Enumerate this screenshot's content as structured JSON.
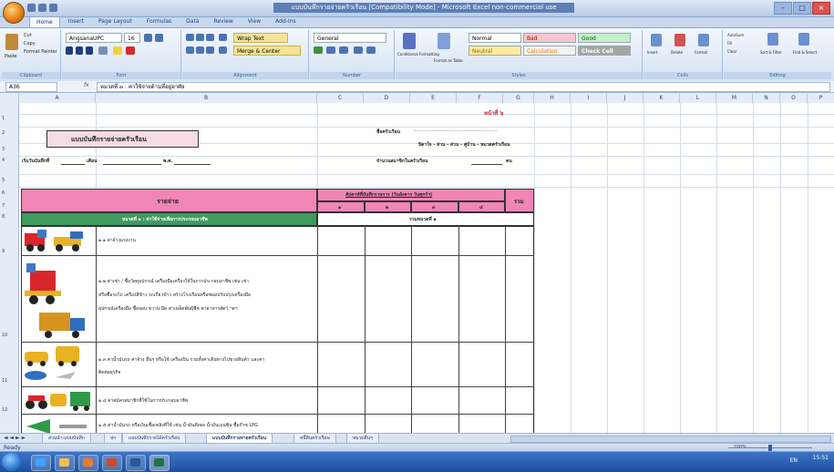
{
  "window": {
    "title": "แบบบันทึกรายจ่ายครัวเรือน [Compatibility Mode] - Microsoft Excel non-commercial use"
  },
  "ribbon": {
    "tabs": [
      "Home",
      "Insert",
      "Page Layout",
      "Formulas",
      "Data",
      "Review",
      "View",
      "Add-Ins"
    ],
    "groups": {
      "clipboard": "Clipboard",
      "font": "Font",
      "alignment": "Alignment",
      "number": "Number",
      "styles": "Styles",
      "cells": "Cells",
      "editing": "Editing"
    },
    "clipboard_items": [
      "Cut",
      "Copy",
      "Format Painter"
    ],
    "paste_label": "Paste",
    "font_name": "AngsanaUPC",
    "font_size": "16",
    "wrap_text": "Wrap Text",
    "merge_center": "Merge & Center",
    "number_format": "General",
    "conditional_formatting": "Conditional Formatting",
    "format_as_table": "Format as Table",
    "styles": {
      "normal": "Normal",
      "bad": "Bad",
      "good": "Good",
      "neutral": "Neutral",
      "calculation": "Calculation",
      "check_cell": "Check Cell"
    },
    "cells_items": [
      "Insert",
      "Delete",
      "Format"
    ],
    "editing_items": [
      "AutoSum",
      "Fill",
      "Clear",
      "Sort & Filter",
      "Find & Select"
    ]
  },
  "formula_bar": {
    "name_box": "A36",
    "fx": "fx",
    "value": "หมวดที่ ๓ : ค่าใช้จ่ายด้านที่อยู่อาศัย"
  },
  "columns": [
    "A",
    "B",
    "C",
    "D",
    "E",
    "F",
    "G",
    "H",
    "I",
    "J",
    "K",
    "L",
    "M",
    "N",
    "O",
    "P"
  ],
  "rows": [
    "1",
    "2",
    "3",
    "4",
    "5",
    "6",
    "7",
    "8",
    "9",
    "10",
    "11",
    "12"
  ],
  "sheet": {
    "page_no": "หน้าที่ ๖",
    "form_title": "แบบบันทึกรายจ่ายครัวเรือน",
    "recorder_label": "ชื่อครัวเรือน",
    "recorder_fill": "..........................................................",
    "relation_label": "บิดาใจ - ส่วน - ส่วน - คู่บ้าน - หมวดครัวเรือน",
    "start_date_label": "เริ่มวันบันทึกที่",
    "month_label": "เดือน",
    "year_label": "พ.ศ.",
    "members_label": "จำนวนสมาชิกในครัวเรือน",
    "members_unit": "คน",
    "header_item": "รายจ่าย",
    "header_weeks": "สัปดาห์ที่บันทึกรายการ (วันอังคาร วันศุกร์ฯ)",
    "week_numbers": [
      "๑",
      "๒",
      "๓",
      "๔"
    ],
    "header_total": "รวม",
    "category_row": "หมวดที่ ๑ : ค่าใช้จ่ายเพื่อการประกอบอาชีพ",
    "category_total": "รวมหมวดที่ ๑",
    "items": [
      {
        "text": "๑.๑ ค่าจ้างแรงงาน"
      },
      {
        "text_lines": [
          "๑.๒ ค่าเช่า / ซื้อวัสดุอุปกรณ์ เครื่องมือเครื่องใช้ในการประกอบอาชีพ เช่น เช่า",
          "หรือซื้อรถไถ เครื่องสีข้าว รถเกี่ยวข้าว สร้างโรงเรือนหรือซ่อมปรับปรุงเครื่องมือ",
          "อุปกรณ์เครื่องมือ ซื้อจอบ ขวาน มีด ค่าเมล็ดพันธุ์พืช ค่าอาหารสัตว์ ฯลฯ"
        ]
      },
      {
        "text_lines": [
          "๑.๓ ค่าน้ำมันรถ ค่าจ้าง อื่นๆ หรือใช้ เครื่องบิน รวมทั้งค่าเดินทางไปขายสินค้า และค่า",
          "ติดต่อธุรกิจ"
        ]
      },
      {
        "text": "๑.๔ ค่าสมัครสมาชิกที่ใช้ในการประกอบอาชีพ"
      },
      {
        "text": "๑.๕ ค่าน้ำมันรถ หรือเงินเชื้อเพลิงที่ใช้ เช่น น้ำมันดีเซล น้ำมันเบนซิน ซื้อก๊าซ LPG"
      }
    ]
  },
  "sheet_tabs": [
    "ส่วนนำ-แบบบันทึก",
    "ปก",
    "แบบบันทึกรายได้ครัวเรือน",
    "แบบบันทึกรายจ่ายครัวเรือน",
    "หนี้สินครัวเรือน",
    "หมวดอื่นๆ"
  ],
  "status": {
    "ready": "Ready",
    "zoom": "100%"
  },
  "taskbar": {
    "time": "15:51",
    "lang": "EN"
  }
}
